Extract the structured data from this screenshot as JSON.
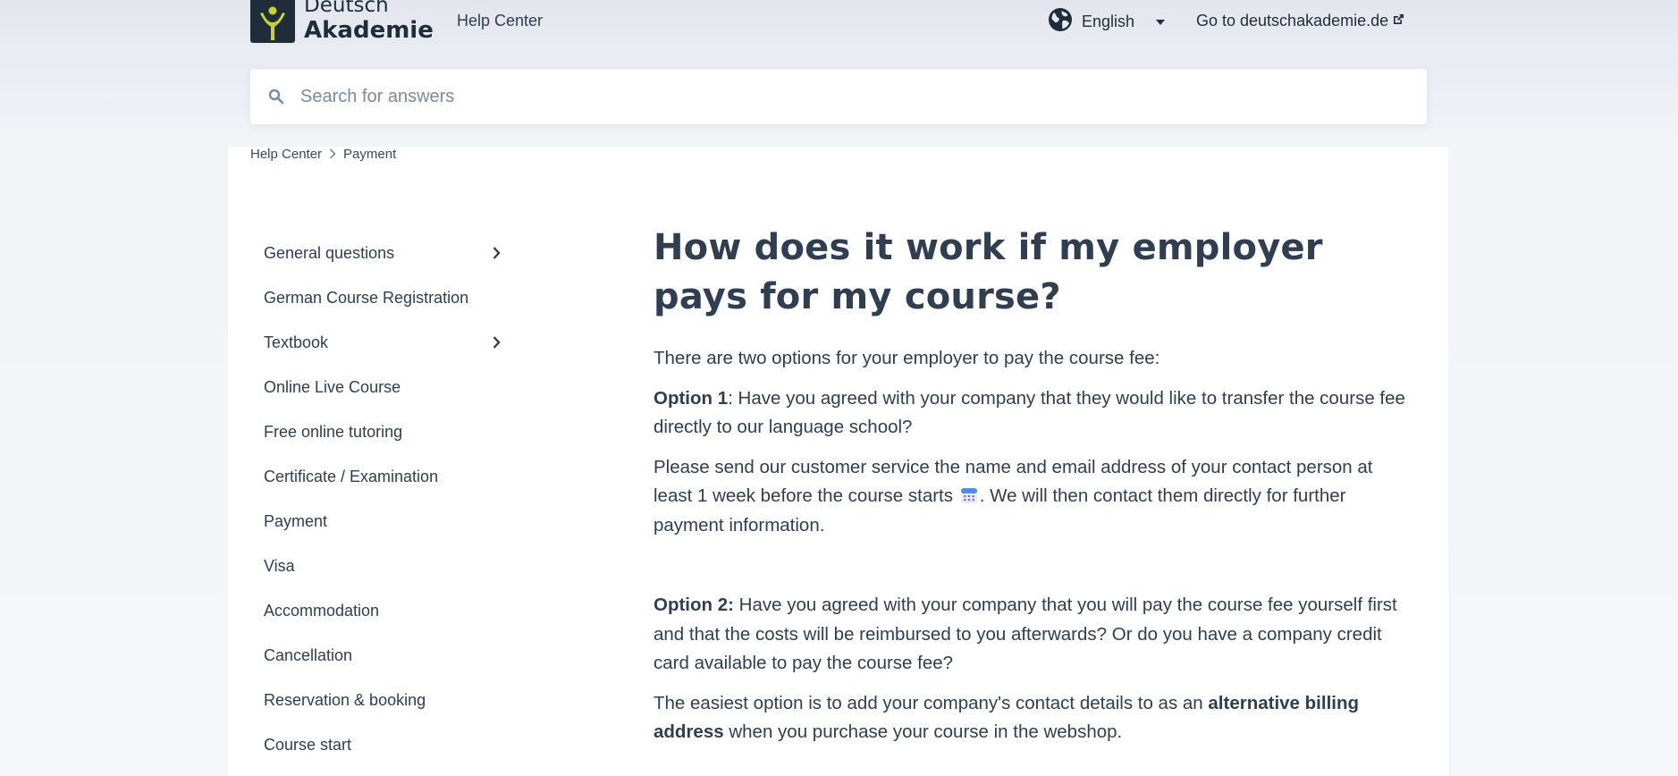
{
  "header": {
    "logo_line1": "Deutsch",
    "logo_line2": "Akademie",
    "help_center": "Help Center",
    "language": "English",
    "goto_label": "Go to deutschakademie.de"
  },
  "search": {
    "placeholder": "Search for answers"
  },
  "breadcrumb": {
    "items": [
      "Help Center",
      "Payment"
    ]
  },
  "sidebar": {
    "items": [
      {
        "label": "General questions",
        "has_children": true
      },
      {
        "label": "German Course Registration",
        "has_children": false
      },
      {
        "label": "Textbook",
        "has_children": true
      },
      {
        "label": "Online Live Course",
        "has_children": false
      },
      {
        "label": "Free online tutoring",
        "has_children": false
      },
      {
        "label": "Certificate / Examination",
        "has_children": false
      },
      {
        "label": "Payment",
        "has_children": false
      },
      {
        "label": "Visa",
        "has_children": false
      },
      {
        "label": "Accommodation",
        "has_children": false
      },
      {
        "label": "Cancellation",
        "has_children": false
      },
      {
        "label": "Reservation & booking",
        "has_children": false
      },
      {
        "label": "Course start",
        "has_children": false
      }
    ]
  },
  "article": {
    "title": "How does it work if my employer pays for my course?",
    "intro": "There are two options for your employer to pay the course fee:",
    "option1_label": "Option 1",
    "option1_text": ": Have you agreed with your company that they would like to transfer the course fee directly to our language school?",
    "option1_detail_a": "Please send our customer service the name and email address of your contact person at least 1 week before the course starts ",
    "option1_detail_b": ". We will then contact them directly for further payment information.",
    "option2_label": "Option 2:",
    "option2_text": " Have you agreed with your company that you will pay the course fee yourself first and that the costs will be reimbursed to you afterwards? Or do you have a company credit card available to pay the course fee?",
    "option2_detail_a": "The easiest option is to add your company's contact details to as an ",
    "option2_detail_bold": "alternative billing address",
    "option2_detail_b": " when you purchase your course in the webshop."
  },
  "icons": {
    "logo": "deutsch-akademie-logo",
    "globe": "globe-icon",
    "external": "external-link-icon",
    "search": "search-icon",
    "calendar": "calendar-emoji-icon",
    "chevron": "chevron-right-icon"
  },
  "colors": {
    "logo_accent": "#c8d42a",
    "text": "#2f3e50",
    "search_icon": "#6f8db0"
  }
}
